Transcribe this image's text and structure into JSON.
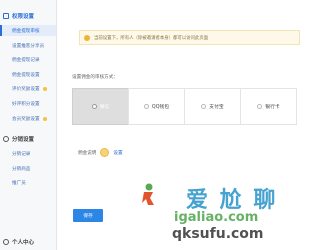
{
  "sidebar": {
    "section1_title": "权限设置",
    "section2_title": "分销设置",
    "section3_title": "个人中心",
    "section1_items": [
      {
        "label": "佣金提现审核",
        "active": true
      },
      {
        "label": "设置推客分享员"
      },
      {
        "label": "佣金提现记录"
      },
      {
        "label": "佣金提现设置"
      },
      {
        "label": "评价奖励设置",
        "badge": true
      },
      {
        "label": "好评积分设置"
      },
      {
        "label": "会员奖励设置",
        "badge": true
      }
    ],
    "section2_items": [
      {
        "label": "分销记录"
      },
      {
        "label": "分销商品"
      },
      {
        "label": "推广员"
      }
    ]
  },
  "notice": {
    "text": "当前设置下，所有人（除被邀请者本身）都可以访问此页面"
  },
  "main": {
    "prompt": "设置佣金的审核方式：",
    "options": [
      {
        "label": "微信",
        "selected": true
      },
      {
        "label": "QQ钱包"
      },
      {
        "label": "支付宝"
      },
      {
        "label": "银行卡"
      }
    ],
    "field": {
      "label": "佣金说明",
      "link": "设置"
    },
    "save_label": "保存"
  },
  "watermark": {
    "chinese": "爱 尬 聊",
    "url1": "igaliao.com",
    "url2": "qksufu.com"
  }
}
